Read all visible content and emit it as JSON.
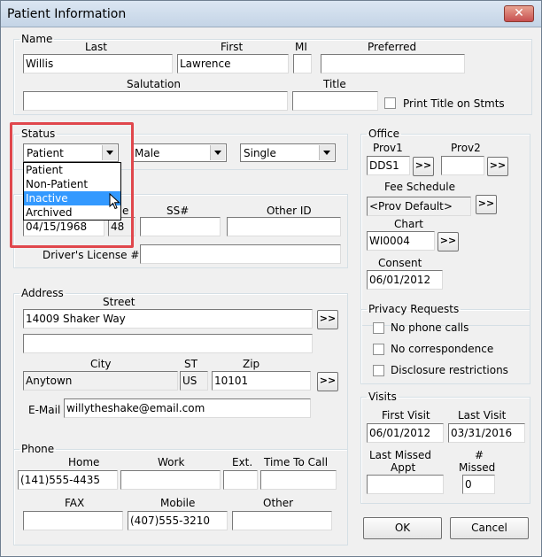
{
  "window": {
    "title": "Patient Information",
    "close_glyph": "✕"
  },
  "name_group": {
    "legend": "Name",
    "last_label": "Last",
    "last_value": "Willis",
    "first_label": "First",
    "first_value": "Lawrence",
    "mi_label": "MI",
    "mi_value": "",
    "preferred_label": "Preferred",
    "preferred_value": "",
    "salutation_label": "Salutation",
    "salutation_value": "",
    "title_label": "Title",
    "title_value": "",
    "print_title_label": "Print Title on Stmts",
    "print_title_checked": false
  },
  "status_group": {
    "legend": "Status",
    "status_value": "Patient",
    "gender_value": "Male",
    "marital_value": "Single",
    "dropdown_options": [
      "Patient",
      "Non-Patient",
      "Inactive",
      "Archived"
    ],
    "dropdown_selected": "Inactive"
  },
  "id_group": {
    "birthdate_value": "04/15/1968",
    "age_partial_label": "e",
    "age_value": "48",
    "ss_label": "SS#",
    "ss_value": "",
    "other_id_label": "Other ID",
    "other_id_value": "",
    "drivers_license_label": "Driver's License #",
    "drivers_license_value": ""
  },
  "address_group": {
    "legend": "Address",
    "street_label": "Street",
    "street1_value": "14009 Shaker Way",
    "street2_value": "",
    "city_label": "City",
    "city_value": "Anytown",
    "st_label": "ST",
    "st_value": "US",
    "zip_label": "Zip",
    "zip_value": "10101",
    "email_label": "E-Mail",
    "email_value": "willytheshake@email.com",
    "more_glyph": ">>"
  },
  "phone_group": {
    "legend": "Phone",
    "home_label": "Home",
    "home_value": "(141)555-4435",
    "work_label": "Work",
    "work_value": "",
    "ext_label": "Ext.",
    "ext_value": "",
    "time_to_call_label": "Time To Call",
    "time_to_call_value": "",
    "fax_label": "FAX",
    "fax_value": "",
    "mobile_label": "Mobile",
    "mobile_value": "(407)555-3210",
    "other_label": "Other",
    "other_value": ""
  },
  "office_group": {
    "legend": "Office",
    "prov1_label": "Prov1",
    "prov1_value": "DDS1",
    "prov2_label": "Prov2",
    "prov2_value": "",
    "fee_schedule_label": "Fee Schedule",
    "fee_schedule_value": "<Prov Default>",
    "chart_label": "Chart",
    "chart_value": "WI0004",
    "consent_label": "Consent",
    "consent_value": "06/01/2012",
    "more_glyph": ">>"
  },
  "privacy_group": {
    "legend": "Privacy Requests",
    "no_phone_calls": "No phone calls",
    "no_correspondence": "No correspondence",
    "disclosure_restrictions": "Disclosure restrictions"
  },
  "visits_group": {
    "legend": "Visits",
    "first_visit_label": "First Visit",
    "first_visit_value": "06/01/2012",
    "last_visit_label": "Last Visit",
    "last_visit_value": "03/31/2016",
    "last_missed_appt_label_1": "Last Missed",
    "last_missed_appt_label_2": "Appt",
    "last_missed_appt_value": "",
    "num_missed_label_1": "#",
    "num_missed_label_2": "Missed",
    "num_missed_value": "0"
  },
  "buttons": {
    "ok": "OK",
    "cancel": "Cancel"
  },
  "colors": {
    "highlight": "#e0474c",
    "selection": "#3399ff"
  }
}
